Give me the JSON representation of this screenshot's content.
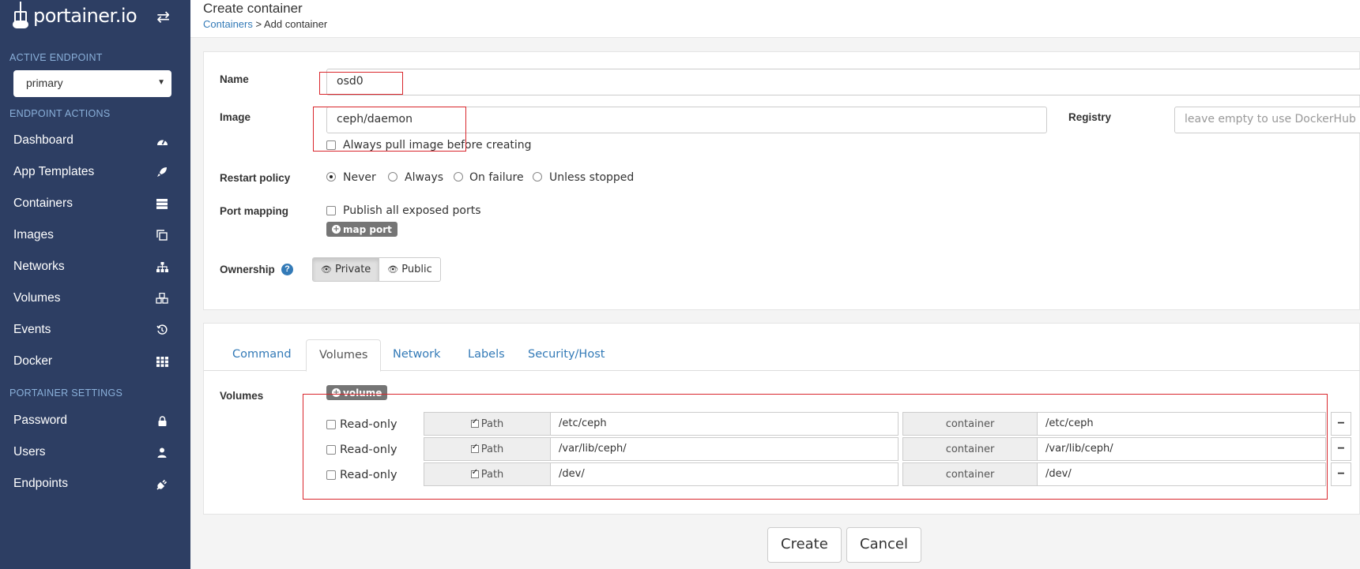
{
  "sidebar": {
    "logo_text": "portainer.io",
    "active_endpoint_title": "ACTIVE ENDPOINT",
    "endpoint_value": "primary",
    "endpoint_actions_title": "ENDPOINT ACTIONS",
    "items": [
      {
        "label": "Dashboard",
        "icon": "dashboard-icon"
      },
      {
        "label": "App Templates",
        "icon": "rocket-icon"
      },
      {
        "label": "Containers",
        "icon": "server-icon"
      },
      {
        "label": "Images",
        "icon": "clone-icon"
      },
      {
        "label": "Networks",
        "icon": "sitemap-icon"
      },
      {
        "label": "Volumes",
        "icon": "cubes-icon"
      },
      {
        "label": "Events",
        "icon": "history-icon"
      },
      {
        "label": "Docker",
        "icon": "th-icon"
      }
    ],
    "portainer_settings_title": "PORTAINER SETTINGS",
    "settings_items": [
      {
        "label": "Password",
        "icon": "lock-icon"
      },
      {
        "label": "Users",
        "icon": "user-icon"
      },
      {
        "label": "Endpoints",
        "icon": "plug-icon"
      }
    ]
  },
  "header": {
    "title": "Create container",
    "breadcrumb_link": "Containers",
    "breadcrumb_current": "> Add container"
  },
  "form": {
    "name_label": "Name",
    "name_value": "osd0",
    "image_label": "Image",
    "image_value": "ceph/daemon",
    "always_pull_label": "Always pull image before creating",
    "registry_label": "Registry",
    "registry_placeholder": "leave empty to use DockerHub",
    "restart_policy_label": "Restart policy",
    "restart_options": [
      "Never",
      "Always",
      "On failure",
      "Unless stopped"
    ],
    "restart_selected": "Never",
    "port_mapping_label": "Port mapping",
    "publish_all_label": "Publish all exposed ports",
    "map_port_label": "map port",
    "ownership_label": "Ownership",
    "ownership_private": "Private",
    "ownership_public": "Public"
  },
  "tabs": {
    "items": [
      "Command",
      "Volumes",
      "Network",
      "Labels",
      "Security/Host"
    ],
    "active": "Volumes"
  },
  "volumes": {
    "label": "Volumes",
    "add_label": "volume",
    "readonly_label": "Read-only",
    "path_label": "Path",
    "container_label": "container",
    "rows": [
      {
        "host": "/etc/ceph",
        "container": "/etc/ceph"
      },
      {
        "host": "/var/lib/ceph/",
        "container": "/var/lib/ceph/"
      },
      {
        "host": "/dev/",
        "container": "/dev/"
      }
    ]
  },
  "actions": {
    "create_label": "Create",
    "cancel_label": "Cancel"
  }
}
